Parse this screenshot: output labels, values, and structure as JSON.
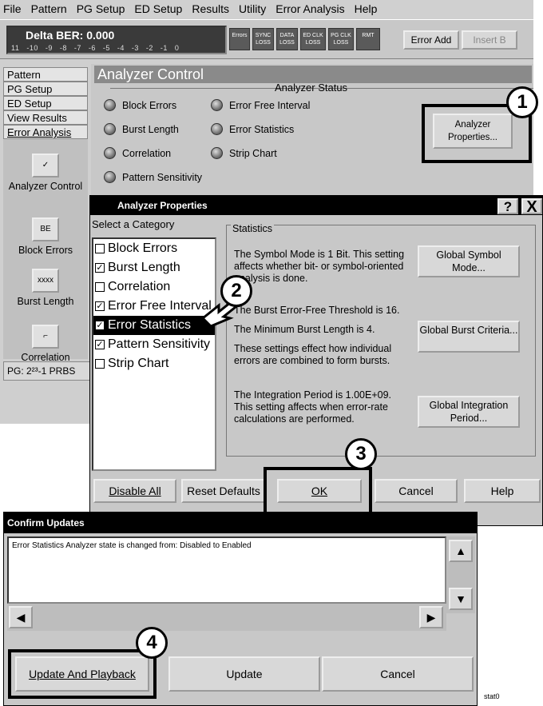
{
  "menu": [
    "File",
    "Pattern",
    "PG Setup",
    "ED Setup",
    "Results",
    "Utility",
    "Error Analysis",
    "Help"
  ],
  "menu_underline": [
    "F",
    "P",
    "G",
    "D",
    "R",
    "U",
    "E",
    "H"
  ],
  "toolbar": {
    "ber_label": "Delta BER: 0.000",
    "ber_scale": "11 -10 -9 -8 -7 -6 -5 -4 -3 -2 -1 0",
    "indicators": [
      "Errors",
      "SYNC LOSS",
      "DATA LOSS",
      "ED CLK LOSS",
      "PG CLK LOSS",
      "RMT"
    ],
    "error_add": "Error Add",
    "insert_b": "Insert B"
  },
  "sidebar": {
    "links": [
      "Pattern",
      "PG Setup",
      "ED Setup",
      "View Results",
      "Error Analysis"
    ],
    "tools": [
      {
        "label": "Analyzer Control",
        "icon": "analyzer-control-icon",
        "glyph": "✓"
      },
      {
        "label": "Block Errors",
        "icon": "block-errors-icon",
        "glyph": "BE"
      },
      {
        "label": "Burst Length",
        "icon": "burst-length-icon",
        "glyph": "xxxx"
      },
      {
        "label": "Correlation",
        "icon": "correlation-icon",
        "glyph": "⌐"
      }
    ],
    "status": "PG: 2²³-1 PRBS"
  },
  "panel": {
    "title": "Analyzer Control",
    "status_legend": "Analyzer Status",
    "status_items": [
      "Block Errors",
      "Error Free Interval",
      "Burst Length",
      "Error Statistics",
      "Correlation",
      "Strip Chart",
      "Pattern Sensitivity"
    ],
    "properties_button": "Analyzer Properties..."
  },
  "props_dialog": {
    "title": "Analyzer Properties",
    "help": "?",
    "close": "X",
    "category_label": "Select a Category",
    "categories": [
      {
        "label": "Block Errors",
        "checked": false
      },
      {
        "label": "Burst Length",
        "checked": true
      },
      {
        "label": "Correlation",
        "checked": false
      },
      {
        "label": "Error Free Interval",
        "checked": true
      },
      {
        "label": "Error Statistics",
        "checked": true,
        "selected": true
      },
      {
        "label": "Pattern Sensitivity",
        "checked": true
      },
      {
        "label": "Strip Chart",
        "checked": false
      }
    ],
    "stats_legend": "Statistics",
    "symbol_text": "The Symbol Mode is 1 Bit. This setting affects whether bit- or symbol-oriented analysis is done.",
    "threshold_text": "The Burst Error-Free Threshold is 16.",
    "min_burst_text": "The Minimum Burst Length is 4.",
    "burst_effect_text": "These settings effect how individual errors are combined to form bursts.",
    "integration_text": "The Integration Period is 1.00E+09. This setting affects when error-rate calculations are performed.",
    "global_symbol": "Global Symbol Mode...",
    "global_burst": "Global Burst Criteria...",
    "global_integration": "Global Integration Period...",
    "disable_all": "Disable All",
    "reset_defaults": "Reset Defaults",
    "ok": "OK",
    "cancel": "Cancel",
    "help_btn": "Help"
  },
  "confirm": {
    "title": "Confirm Updates",
    "message": "Error Statistics Analyzer state is changed from: Disabled to Enabled",
    "update_playback": "Update And Playback",
    "update": "Update",
    "cancel": "Cancel"
  },
  "callouts": [
    "1",
    "2",
    "3",
    "4"
  ],
  "figure_tag": "stat0"
}
